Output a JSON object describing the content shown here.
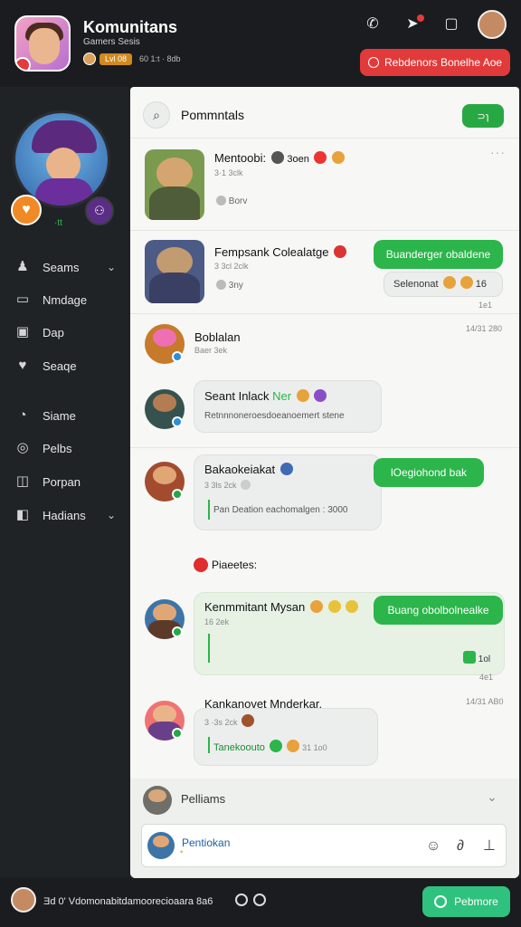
{
  "header": {
    "title": "Komunitans",
    "subtitle": "Gamers Sesis",
    "level": "Lvl 08",
    "stats": "60 1:t · 8db",
    "icons": [
      "phone-icon",
      "notification-icon",
      "chat-icon"
    ],
    "cta_label": "Rebdenors Bonelhe Aoe"
  },
  "sidebar": {
    "mini_label": "·tt",
    "items": [
      {
        "label": "Seams",
        "icon": "users-icon",
        "chevron": true
      },
      {
        "label": "Nmdage",
        "icon": "card-icon",
        "chevron": false
      },
      {
        "label": "Dap",
        "icon": "calendar-icon",
        "chevron": false
      },
      {
        "label": "Seaqe",
        "icon": "heart-icon",
        "chevron": false
      },
      {
        "label": "Siame",
        "icon": "clock-icon",
        "chevron": false
      },
      {
        "label": "Pelbs",
        "icon": "compass-icon",
        "chevron": false
      },
      {
        "label": "Porpan",
        "icon": "chart-icon",
        "chevron": false
      },
      {
        "label": "Hadians",
        "icon": "toggle-icon",
        "chevron": true
      }
    ]
  },
  "main": {
    "search_label": "Pommntals",
    "search_button": "⊃ɿ",
    "items": [
      {
        "title": "Mentoobi:",
        "title_extra": "3oen",
        "meta": "3·1 3clk",
        "sub": "Borv"
      },
      {
        "title": "Fempsank Colealatge",
        "meta": "3 3cl 2clk",
        "sub": "3ny",
        "button": "Buanderger obaldene",
        "pill": "Selenonat",
        "pill_count": "16",
        "time": "1e1"
      },
      {
        "title": "Boblalan",
        "meta": "Baer 3ek",
        "time": "14/31 280"
      },
      {
        "title": "Seant Inlack",
        "title_green": "Ner",
        "sub": "Retnnnoneroesdoeanoemert stene"
      },
      {
        "title": "Bakaokeiakat",
        "meta": "3 3ls 2ck",
        "sub": "Pan Deation eachomalgen : 3000",
        "button": "lOegiohond bak"
      },
      {
        "label": "Piaeetes:"
      },
      {
        "title": "Kenmmitant Mysan",
        "meta": "16 2ek",
        "button": "Buang obolbolnealke",
        "count": "1ol",
        "time": "4e1"
      },
      {
        "title": "Kankanovet Mnderkar.",
        "meta": "3 ·3s 2ck",
        "sub": "Tanekoouto",
        "time": "14/31 AB0",
        "sub_meta": "31 1o0"
      }
    ],
    "composer_label": "Pelliams",
    "composer_name": "Pentiokan",
    "composer_meta": "•"
  },
  "footer": {
    "text": "Ǝd 0' Vdomonabitdamoorecioaara   8a6",
    "button": "Pebmore"
  },
  "colors": {
    "accent_green": "#2bb54a",
    "accent_red": "#e23a3a",
    "header_bg": "#1a1c1f"
  }
}
